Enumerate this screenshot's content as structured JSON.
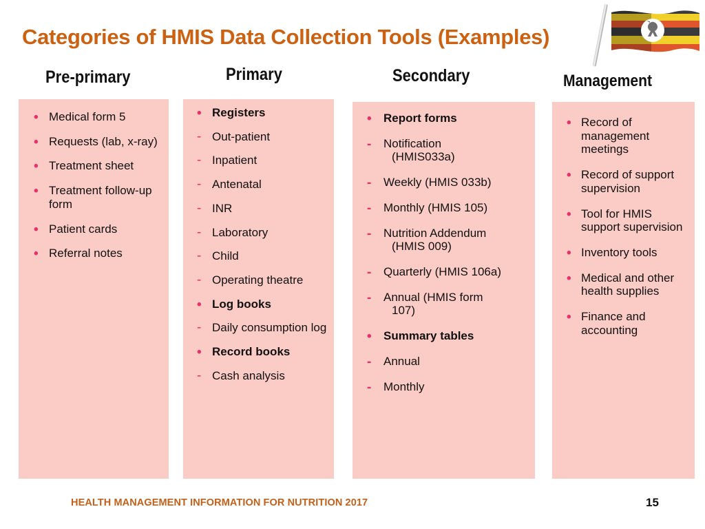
{
  "slide": {
    "title": "Categories of HMIS Data Collection Tools (Examples)",
    "title_color": "#CC6111",
    "panel_color": "#FBCBC6",
    "bullet_color": "#E8316B",
    "page_number": "15",
    "footer": "HEALTH MANAGEMENT INFORMATION FOR NUTRITION 2017"
  },
  "flag": {
    "name": "uganda-flag",
    "stripe_colors": [
      "#3b3b3b",
      "#F2D02C",
      "#E0562C",
      "#3b3b3b",
      "#F2D02C",
      "#E0562C"
    ],
    "emblem": "crested-crane"
  },
  "columns": [
    {
      "header": "Pre-primary",
      "items": [
        {
          "marker": "bullet",
          "text": "Medical form 5",
          "bold": false
        },
        {
          "marker": "bullet",
          "text": "Requests (lab, x-ray)",
          "bold": false
        },
        {
          "marker": "bullet",
          "text": "Treatment sheet",
          "bold": false
        },
        {
          "marker": "bullet",
          "text": "Treatment follow-up form",
          "bold": false
        },
        {
          "marker": "bullet",
          "text": "Patient cards",
          "bold": false
        },
        {
          "marker": "bullet",
          "text": "Referral notes",
          "bold": false
        }
      ]
    },
    {
      "header": "Primary",
      "items": [
        {
          "marker": "bullet",
          "text": "Registers",
          "bold": true
        },
        {
          "marker": "dash",
          "text": "Out-patient",
          "bold": false
        },
        {
          "marker": "dash",
          "text": "Inpatient",
          "bold": false
        },
        {
          "marker": "dash",
          "text": "Antenatal",
          "bold": false
        },
        {
          "marker": "dash",
          "text": "INR",
          "bold": false
        },
        {
          "marker": "dash",
          "text": "Laboratory",
          "bold": false
        },
        {
          "marker": "dash",
          "text": "Child",
          "bold": false
        },
        {
          "marker": "dash",
          "text": "Operating theatre",
          "bold": false
        },
        {
          "marker": "bullet",
          "text": "Log books",
          "bold": true
        },
        {
          "marker": "dash",
          "text": "Daily consumption log",
          "bold": false
        },
        {
          "marker": "bullet",
          "text": "Record books",
          "bold": true
        },
        {
          "marker": "dash",
          "text": "Cash analysis",
          "bold": false
        }
      ]
    },
    {
      "header": "Secondary",
      "items": [
        {
          "marker": "bullet",
          "text": "Report forms",
          "bold": true
        },
        {
          "marker": "dash",
          "text": "Notification",
          "sub": "(HMIS033a)",
          "bold": false
        },
        {
          "marker": "dash",
          "text": "Weekly (HMIS 033b)",
          "bold": false
        },
        {
          "marker": "dash",
          "text": "Monthly (HMIS 105)",
          "bold": false
        },
        {
          "marker": "dash",
          "text": "Nutrition Addendum",
          "sub": "(HMIS 009)",
          "bold": false
        },
        {
          "marker": "dash",
          "text": "Quarterly (HMIS 106a)",
          "bold": false
        },
        {
          "marker": "dash",
          "text": "Annual (HMIS form",
          "sub": "107)",
          "bold": false
        },
        {
          "marker": "bullet",
          "text": "Summary tables",
          "bold": true
        },
        {
          "marker": "dash",
          "text": "Annual",
          "bold": false
        },
        {
          "marker": "dash",
          "text": "Monthly",
          "bold": false
        }
      ]
    },
    {
      "header": "Management",
      "items": [
        {
          "marker": "bullet",
          "text": "Record of management meetings",
          "bold": false
        },
        {
          "marker": "bullet",
          "text": "Record of support supervision",
          "bold": false
        },
        {
          "marker": "bullet",
          "text": "Tool for HMIS support supervision",
          "bold": false
        },
        {
          "marker": "bullet",
          "text": "Inventory tools",
          "bold": false
        },
        {
          "marker": "bullet",
          "text": "Medical and other health supplies",
          "bold": false
        },
        {
          "marker": "bullet",
          "text": "Finance and accounting",
          "bold": false
        }
      ]
    }
  ]
}
